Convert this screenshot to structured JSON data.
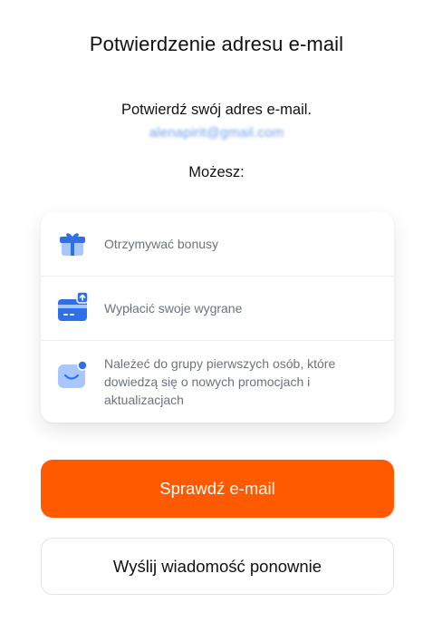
{
  "header": {
    "title": "Potwierdzenie adresu e-mail"
  },
  "confirmation": {
    "text": "Potwierdź swój adres e-mail.",
    "email": "alenapirit@gmail.com"
  },
  "benefits": {
    "heading": "Możesz:",
    "items": [
      {
        "icon": "gift-icon",
        "label": "Otrzymywać bonusy"
      },
      {
        "icon": "wallet-withdraw-icon",
        "label": "Wypłacić swoje wygrane"
      },
      {
        "icon": "notification-smile-icon",
        "label": "Należeć do grupy pierwszych osób, które dowiedzą się o nowych promocjach i aktualizacjach"
      }
    ]
  },
  "actions": {
    "check_email_label": "Sprawdź e-mail",
    "resend_label": "Wyślij wiadomość ponownie"
  },
  "colors": {
    "accent": "#ff5a00",
    "icon_blue": "#2f6fe8",
    "icon_light_blue": "#a9c7ff",
    "muted_text": "#6b7280"
  }
}
